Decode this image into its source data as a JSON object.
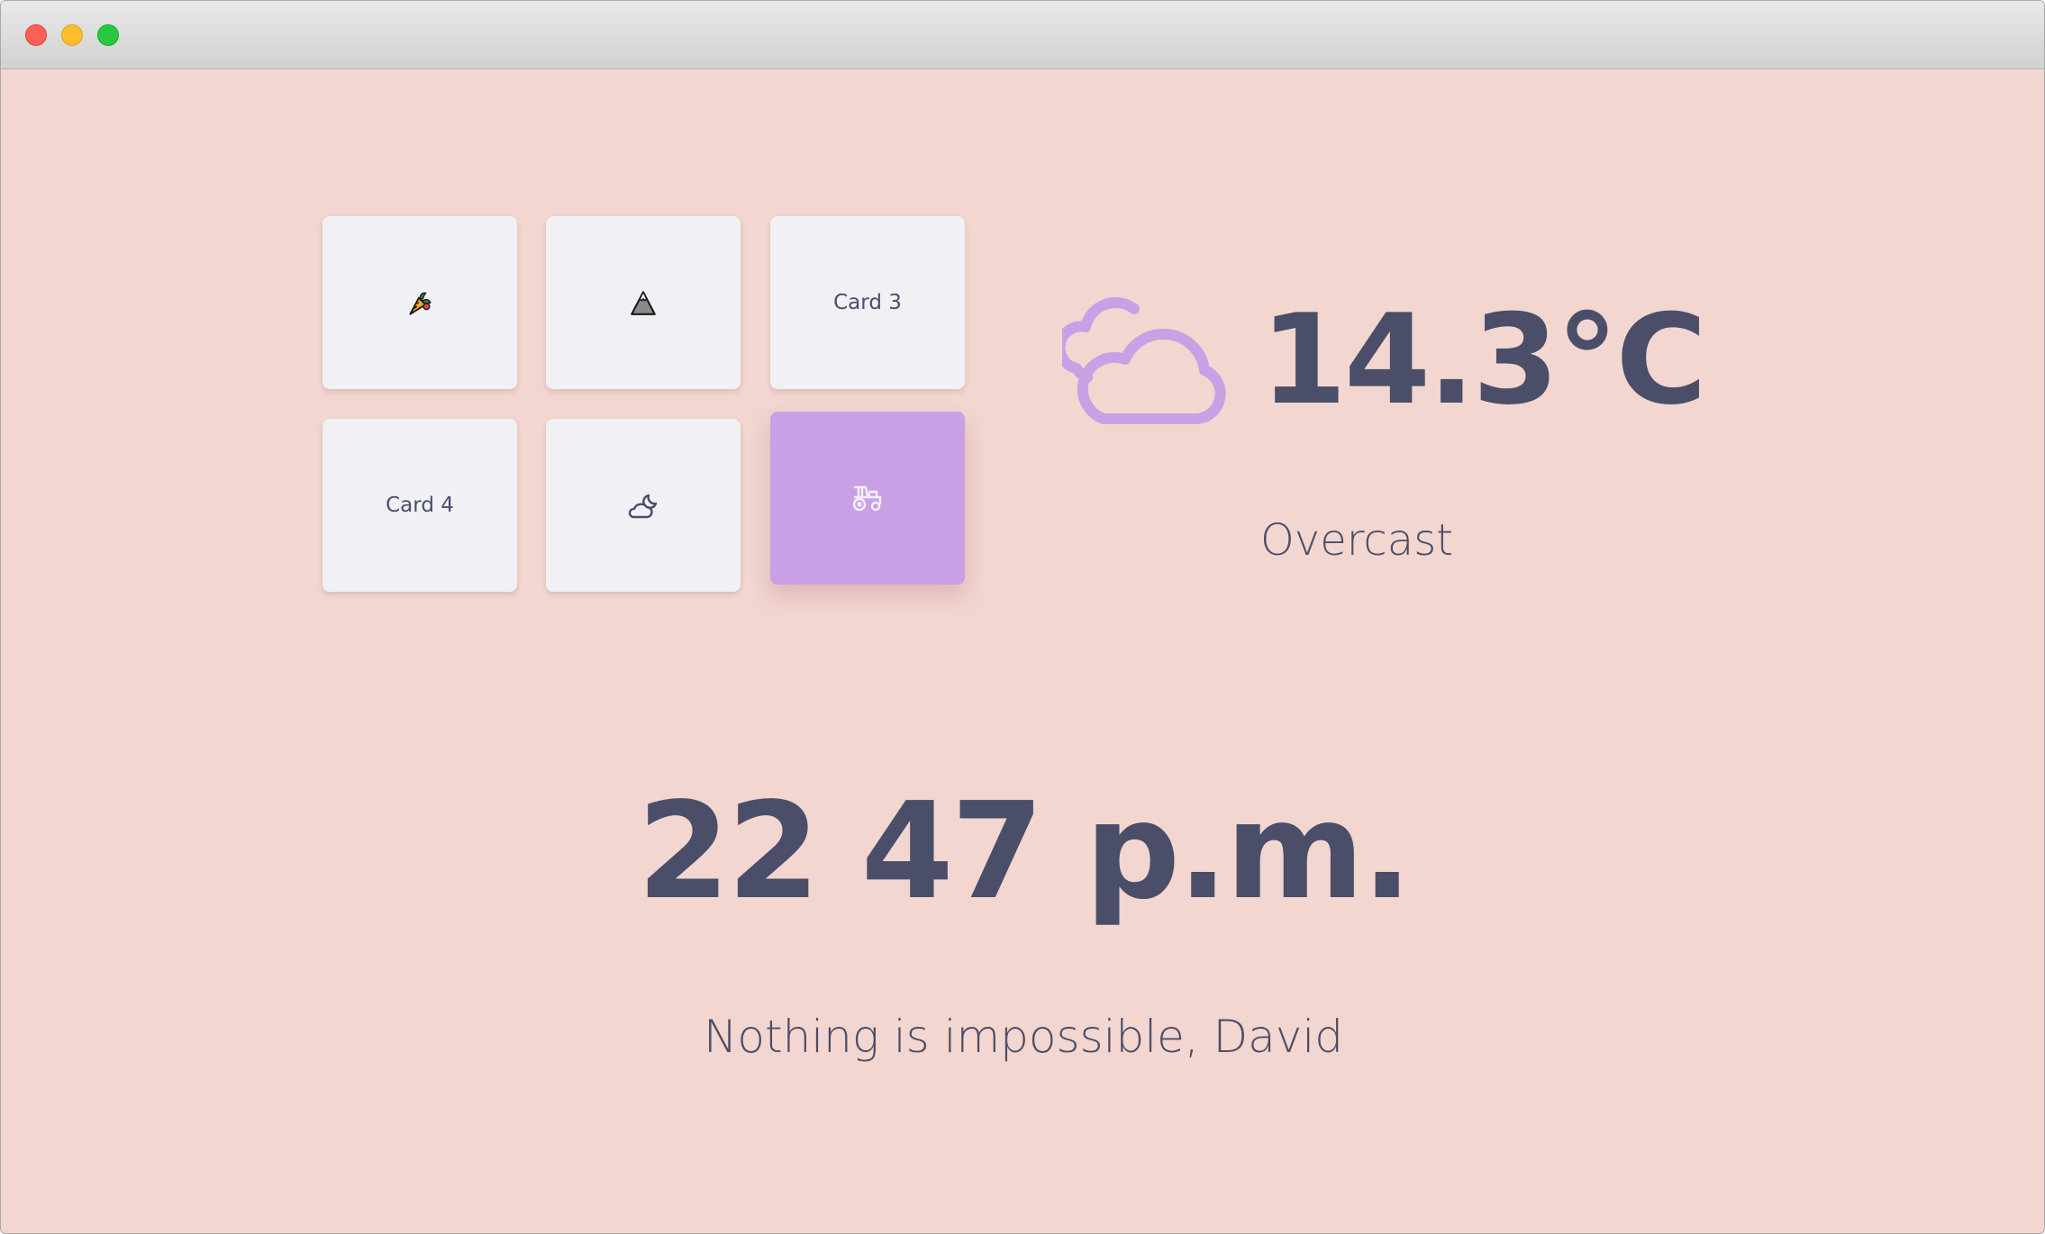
{
  "window": {
    "background": "#f2d6cf",
    "accent": "#c9a0e5",
    "text_color": "#4a4e69"
  },
  "cards": [
    {
      "content": "",
      "icon": "carrot-icon"
    },
    {
      "content": "",
      "icon": "mountain-icon"
    },
    {
      "content": "Card 3",
      "icon": ""
    },
    {
      "content": "Card 4",
      "icon": ""
    },
    {
      "content": "",
      "icon": "cloud-moon-icon"
    },
    {
      "content": "",
      "icon": "tractor-icon",
      "active": true
    }
  ],
  "weather": {
    "icon": "cloud-icon",
    "temperature": "14.3°C",
    "condition": "Overcast"
  },
  "clock": {
    "time": "22 47 p.m."
  },
  "greeting": {
    "text": "Nothing is impossible, David"
  }
}
